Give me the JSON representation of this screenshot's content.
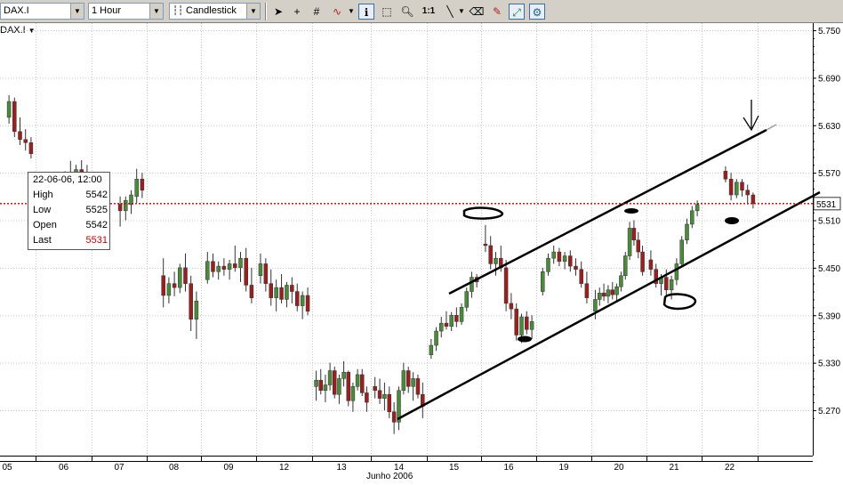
{
  "toolbar": {
    "symbol_value": "DAX.I",
    "interval_value": "1 Hour",
    "chart_style_value": "Candlestick",
    "zoom_label": "1:1"
  },
  "symbol_label": "DAX.I",
  "tooltip": {
    "date": "22-06-06, 12:00",
    "rows": [
      {
        "label": "High",
        "value": "5542"
      },
      {
        "label": "Low",
        "value": "5525"
      },
      {
        "label": "Open",
        "value": "5542"
      },
      {
        "label": "Last",
        "value": "5531"
      }
    ]
  },
  "colors": {
    "up": "#4a8a3a",
    "down": "#9a1f1f",
    "last_price_line": "#cc0000"
  },
  "chart_data": {
    "type": "candlestick",
    "x_tick_labels": [
      "05",
      "06",
      "07",
      "08",
      "09",
      "12",
      "13",
      "14",
      "15",
      "16",
      "19",
      "20",
      "21",
      "22"
    ],
    "x_axis_label": "Junho 2006",
    "y_tick_labels": [
      "5.750",
      "5.690",
      "5.630",
      "5.570",
      "5.510",
      "5.450",
      "5.390",
      "5.330",
      "5.270"
    ],
    "ylim": [
      5212,
      5768
    ],
    "last_price": 5531,
    "last_price_label": "5531",
    "grid": true,
    "candles": [
      {
        "day": "05",
        "ohlc": [
          [
            5640,
            5668,
            5632,
            5660
          ],
          [
            5660,
            5665,
            5615,
            5622
          ],
          [
            5622,
            5640,
            5605,
            5612
          ],
          [
            5612,
            5625,
            5598,
            5608
          ],
          [
            5608,
            5615,
            5588,
            5594
          ]
        ]
      },
      {
        "day": "06",
        "ohlc": [
          [
            5530,
            5572,
            5525,
            5565
          ],
          [
            5565,
            5585,
            5548,
            5555
          ],
          [
            5555,
            5580,
            5530,
            5574
          ],
          [
            5574,
            5586,
            5545,
            5552
          ],
          [
            5552,
            5580,
            5526,
            5568
          ]
        ]
      },
      {
        "day": "07",
        "ohlc": [
          [
            5530,
            5540,
            5502,
            5522
          ],
          [
            5522,
            5540,
            5510,
            5535
          ],
          [
            5530,
            5548,
            5518,
            5542
          ],
          [
            5540,
            5575,
            5532,
            5562
          ],
          [
            5562,
            5570,
            5538,
            5548
          ]
        ]
      },
      {
        "day": "08",
        "ohlc": [
          [
            5440,
            5462,
            5400,
            5415
          ],
          [
            5415,
            5438,
            5405,
            5430
          ],
          [
            5430,
            5445,
            5414,
            5425
          ],
          [
            5425,
            5455,
            5418,
            5450
          ],
          [
            5450,
            5468,
            5420,
            5430
          ],
          [
            5430,
            5440,
            5370,
            5385
          ],
          [
            5385,
            5420,
            5360,
            5408
          ]
        ]
      },
      {
        "day": "09",
        "ohlc": [
          [
            5435,
            5470,
            5430,
            5458
          ],
          [
            5458,
            5468,
            5438,
            5445
          ],
          [
            5445,
            5458,
            5435,
            5452
          ],
          [
            5452,
            5462,
            5440,
            5448
          ],
          [
            5448,
            5460,
            5435,
            5455
          ],
          [
            5455,
            5478,
            5445,
            5450
          ],
          [
            5450,
            5470,
            5432,
            5462
          ],
          [
            5462,
            5475,
            5420,
            5428
          ],
          [
            5428,
            5450,
            5405,
            5412
          ]
        ]
      },
      {
        "day": "12",
        "ohlc": [
          [
            5440,
            5468,
            5430,
            5455
          ],
          [
            5455,
            5462,
            5420,
            5430
          ],
          [
            5430,
            5448,
            5402,
            5412
          ],
          [
            5412,
            5435,
            5395,
            5425
          ],
          [
            5425,
            5442,
            5405,
            5410
          ],
          [
            5410,
            5432,
            5400,
            5428
          ],
          [
            5428,
            5438,
            5405,
            5420
          ],
          [
            5420,
            5430,
            5395,
            5402
          ],
          [
            5402,
            5420,
            5385,
            5415
          ],
          [
            5415,
            5425,
            5390,
            5395
          ]
        ]
      },
      {
        "day": "13",
        "ohlc": [
          [
            5300,
            5320,
            5282,
            5308
          ],
          [
            5308,
            5322,
            5290,
            5295
          ],
          [
            5295,
            5315,
            5280,
            5302
          ],
          [
            5302,
            5330,
            5295,
            5320
          ],
          [
            5320,
            5325,
            5285,
            5290
          ],
          [
            5290,
            5315,
            5278,
            5310
          ],
          [
            5310,
            5332,
            5300,
            5318
          ],
          [
            5318,
            5320,
            5275,
            5282
          ],
          [
            5282,
            5305,
            5268,
            5300
          ],
          [
            5300,
            5322,
            5295,
            5315
          ],
          [
            5315,
            5322,
            5288,
            5292
          ],
          [
            5292,
            5300,
            5268,
            5280
          ]
        ]
      },
      {
        "day": "14",
        "ohlc": [
          [
            5300,
            5312,
            5285,
            5295
          ],
          [
            5295,
            5310,
            5278,
            5285
          ],
          [
            5285,
            5305,
            5270,
            5290
          ],
          [
            5290,
            5300,
            5260,
            5268
          ],
          [
            5268,
            5280,
            5240,
            5255
          ],
          [
            5255,
            5300,
            5245,
            5295
          ],
          [
            5295,
            5330,
            5290,
            5320
          ],
          [
            5320,
            5325,
            5292,
            5300
          ],
          [
            5300,
            5318,
            5282,
            5310
          ],
          [
            5310,
            5315,
            5285,
            5290
          ],
          [
            5290,
            5305,
            5260,
            5275
          ]
        ]
      },
      {
        "day": "15",
        "ohlc": [
          [
            5340,
            5360,
            5335,
            5352
          ],
          [
            5352,
            5375,
            5345,
            5370
          ],
          [
            5370,
            5388,
            5362,
            5380
          ],
          [
            5380,
            5395,
            5372,
            5376
          ],
          [
            5376,
            5394,
            5370,
            5390
          ],
          [
            5390,
            5400,
            5375,
            5382
          ],
          [
            5382,
            5405,
            5378,
            5400
          ],
          [
            5400,
            5425,
            5395,
            5420
          ],
          [
            5420,
            5445,
            5412,
            5438
          ],
          [
            5438,
            5442,
            5425,
            5432
          ]
        ]
      },
      {
        "day": "16",
        "ohlc": [
          [
            5480,
            5504,
            5470,
            5478
          ],
          [
            5478,
            5490,
            5448,
            5455
          ],
          [
            5455,
            5470,
            5440,
            5462
          ],
          [
            5462,
            5478,
            5445,
            5450
          ],
          [
            5450,
            5460,
            5395,
            5405
          ],
          [
            5405,
            5418,
            5385,
            5398
          ],
          [
            5398,
            5405,
            5358,
            5365
          ],
          [
            5365,
            5392,
            5355,
            5388
          ],
          [
            5388,
            5395,
            5366,
            5372
          ],
          [
            5372,
            5390,
            5360,
            5382
          ]
        ]
      },
      {
        "day": "19",
        "ohlc": [
          [
            5420,
            5450,
            5415,
            5445
          ],
          [
            5445,
            5468,
            5440,
            5462
          ],
          [
            5462,
            5478,
            5455,
            5470
          ],
          [
            5470,
            5475,
            5452,
            5458
          ],
          [
            5458,
            5470,
            5448,
            5465
          ],
          [
            5465,
            5472,
            5445,
            5452
          ],
          [
            5452,
            5462,
            5440,
            5448
          ],
          [
            5448,
            5458,
            5425,
            5430
          ],
          [
            5430,
            5445,
            5405,
            5412
          ]
        ]
      },
      {
        "day": "20",
        "ohlc": [
          [
            5395,
            5422,
            5385,
            5410
          ],
          [
            5410,
            5425,
            5402,
            5418
          ],
          [
            5418,
            5430,
            5408,
            5414
          ],
          [
            5414,
            5428,
            5405,
            5422
          ],
          [
            5422,
            5432,
            5410,
            5416
          ],
          [
            5416,
            5430,
            5408,
            5426
          ],
          [
            5426,
            5445,
            5420,
            5440
          ],
          [
            5440,
            5470,
            5435,
            5465
          ],
          [
            5465,
            5508,
            5460,
            5500
          ],
          [
            5500,
            5510,
            5478,
            5485
          ],
          [
            5485,
            5495,
            5462,
            5470
          ],
          [
            5470,
            5478,
            5440,
            5445
          ]
        ]
      },
      {
        "day": "21",
        "ohlc": [
          [
            5460,
            5472,
            5440,
            5448
          ],
          [
            5448,
            5455,
            5425,
            5430
          ],
          [
            5430,
            5442,
            5415,
            5438
          ],
          [
            5438,
            5448,
            5415,
            5422
          ],
          [
            5422,
            5440,
            5410,
            5435
          ],
          [
            5435,
            5462,
            5428,
            5455
          ],
          [
            5455,
            5490,
            5450,
            5485
          ],
          [
            5485,
            5512,
            5480,
            5505
          ],
          [
            5505,
            5528,
            5500,
            5522
          ],
          [
            5522,
            5535,
            5515,
            5530
          ]
        ]
      },
      {
        "day": "22",
        "ohlc": [
          [
            5572,
            5578,
            5558,
            5562
          ],
          [
            5562,
            5570,
            5535,
            5542
          ],
          [
            5542,
            5562,
            5538,
            5558
          ],
          [
            5558,
            5562,
            5540,
            5548
          ],
          [
            5548,
            5555,
            5530,
            5542
          ],
          [
            5542,
            5545,
            5525,
            5531
          ]
        ]
      }
    ]
  }
}
